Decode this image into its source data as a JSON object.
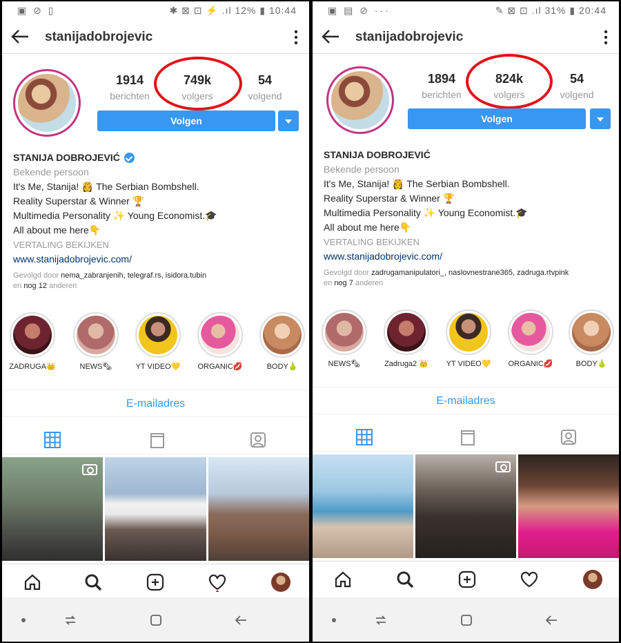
{
  "left": {
    "status": {
      "left_icons": "▣ ⊘ ▯",
      "right": "✱ ⊠ ⊡ ⚡ .ıl 12% ▮ 10:44"
    },
    "username": "stanijadobrojevic",
    "stats": {
      "posts": "1914",
      "posts_label": "berichten",
      "followers": "749k",
      "followers_label": "volgers",
      "following": "54",
      "following_label": "volgend"
    },
    "follow_label": "Volgen",
    "bio": {
      "name": "STANIJA DOBROJEVIĆ",
      "category": "Bekende persoon",
      "line1": "It's Me, Stanija! 👸 The Serbian Bombshell.",
      "line2": "Reality Superstar & Winner 🏆",
      "line3": "Multimedia Personality ✨ Young Economist.🎓",
      "line4": "All about me here👇",
      "translate": "VERTALING BEKIJKEN",
      "website": "www.stanijadobrojevic.com/",
      "followed_prefix": "Gevolgd door",
      "followed_names": "nema_zabranjenih, telegraf.rs, isidora.tubin",
      "followed_suffix_pre": "en",
      "followed_count": "nog 12",
      "followed_suffix": "anderen"
    },
    "highlights": [
      "ZADRUGA👑",
      "NEWS🗞",
      "YT VIDEO💛",
      "ORGANIC💋",
      "BODY🍐"
    ],
    "email_label": "E-mailadres"
  },
  "right": {
    "status": {
      "left_icons": "▣ ▤ ⊘ ···",
      "right": "✎ ⊠ ⊡ .ıl 31% ▮ 20:44"
    },
    "username": "stanijadobrojevic",
    "stats": {
      "posts": "1894",
      "posts_label": "berichten",
      "followers": "824k",
      "followers_label": "volgers",
      "following": "54",
      "following_label": "volgend"
    },
    "follow_label": "Volgen",
    "bio": {
      "name": "STANIJA DOBROJEVIĆ",
      "category": "Bekende persoon",
      "line1": "It's Me, Stanija! 👸 The Serbian Bombshell.",
      "line2": "Reality Superstar & Winner 🏆",
      "line3": "Multimedia Personality ✨ Young Economist.🎓",
      "line4": "All about me here👇",
      "translate": "VERTALING BEKIJKEN",
      "website": "www.stanijadobrojevic.com/",
      "followed_prefix": "Gevolgd door",
      "followed_names": "zadrugamanipulatori_, naslovnestrane365, zadruga.rtvpink",
      "followed_suffix_pre": "en",
      "followed_count": "nog 7",
      "followed_suffix": "anderen"
    },
    "highlights": [
      "NEWS🗞",
      "Zadruga2 👑",
      "YT VIDEO💛",
      "ORGANIC💋",
      "BODY🍐"
    ],
    "email_label": "E-mailadres"
  },
  "colors": {
    "accent": "#3897f0",
    "highlight_circle": "#e3111a"
  }
}
